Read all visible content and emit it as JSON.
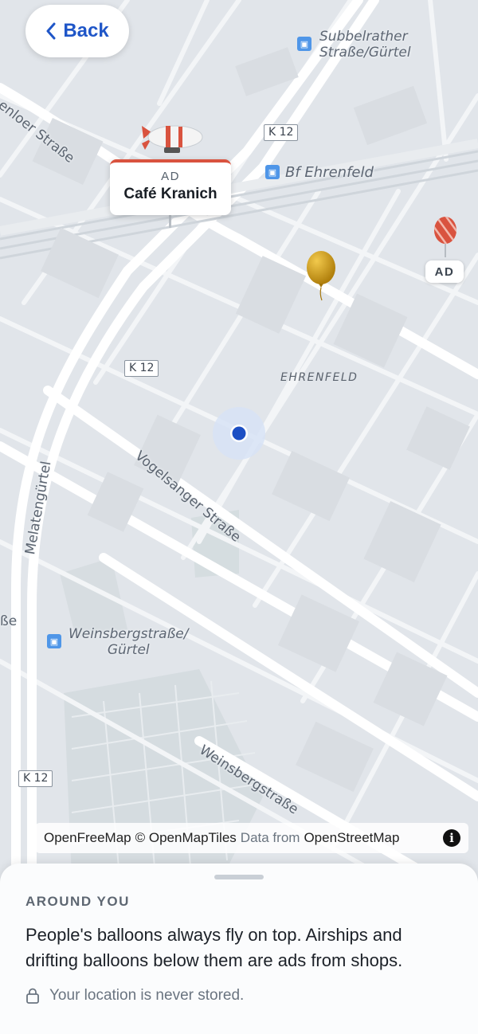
{
  "nav": {
    "back_label": "Back"
  },
  "map": {
    "stations": [
      {
        "name_line1": "Subbelrather",
        "name_line2": "Straße/Gürtel"
      },
      {
        "name_line1": "Bf Ehrenfeld"
      },
      {
        "name_line1": "Weinsbergstraße/",
        "name_line2": "Gürtel"
      }
    ],
    "streets": {
      "venloer": "enloer Straße",
      "vogelsanger": "Vogelsanger Straße",
      "melaten": "Melatengürtel",
      "weinsberg": "Weinsbergstraße",
      "partial_edge": "ße"
    },
    "district": "EHRENFELD",
    "road_shield": "K 12",
    "ads": {
      "card_tag": "AD",
      "card_name": "Café Kranich",
      "pill_tag": "AD"
    },
    "attribution": {
      "openfreemap": "OpenFreeMap",
      "copyright": "© OpenMapTiles",
      "data_from": "Data from",
      "osm": "OpenStreetMap"
    },
    "icons": [
      "chevron-left-icon",
      "bus-icon",
      "airship-icon",
      "balloon-icon",
      "user-location-icon",
      "info-icon",
      "lock-icon"
    ]
  },
  "sheet": {
    "heading": "AROUND YOU",
    "body": "People's balloons always fly on top. Airships and drifting balloons below them are ads from shops.",
    "privacy_note": "Your location is never stored."
  },
  "colors": {
    "accent": "#1f56c8",
    "location_dot": "#1c4fc4",
    "ad_stripe": "#d9533f",
    "map_bg": "#e1e5ea"
  }
}
